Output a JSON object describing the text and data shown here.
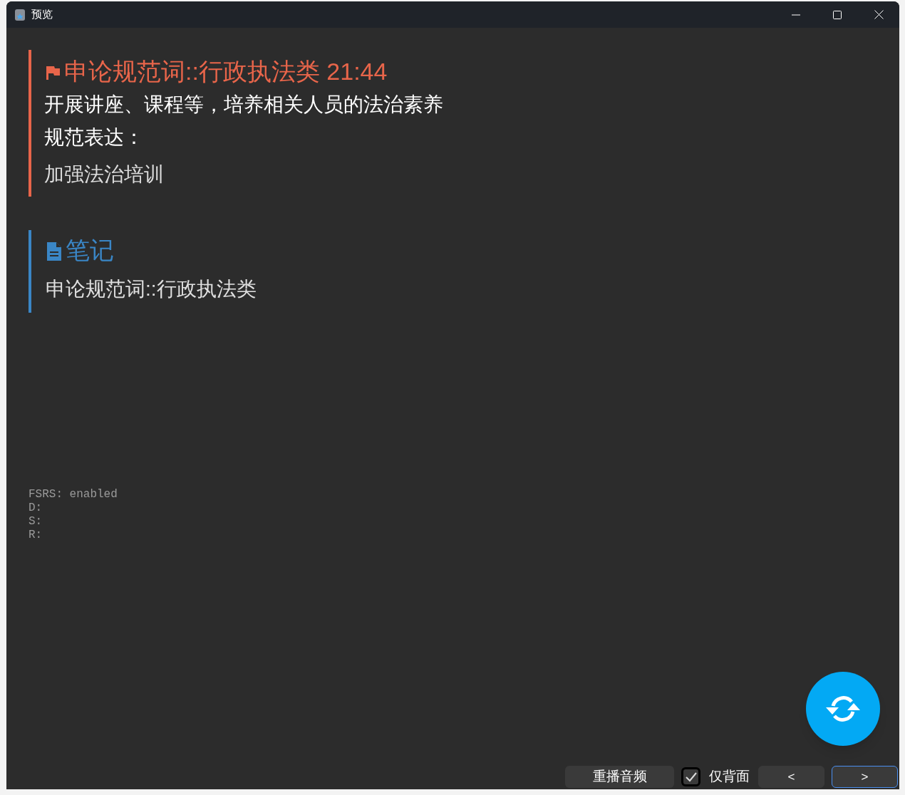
{
  "window": {
    "title": "预览"
  },
  "card": {
    "title": "申论规范词::行政执法类 21:44",
    "lines": [
      {
        "kind": "prompt",
        "text": "开展讲座、课程等，培养相关人员的法治素养"
      },
      {
        "kind": "prompt",
        "text": "规范表达："
      },
      {
        "kind": "answer",
        "text": "加强法治培训"
      }
    ]
  },
  "notes": {
    "title": "笔记",
    "text": "申论规范词::行政执法类"
  },
  "fsrs": [
    "FSRS: enabled",
    "D:",
    "S:",
    "R:"
  ],
  "bottom_bar": {
    "replay_button": "重播音频",
    "back_only": {
      "label": "仅背面",
      "checked": true
    },
    "nav_buttons": [
      {
        "label": "<",
        "focused": false
      },
      {
        "label": ">",
        "focused": true
      }
    ]
  }
}
